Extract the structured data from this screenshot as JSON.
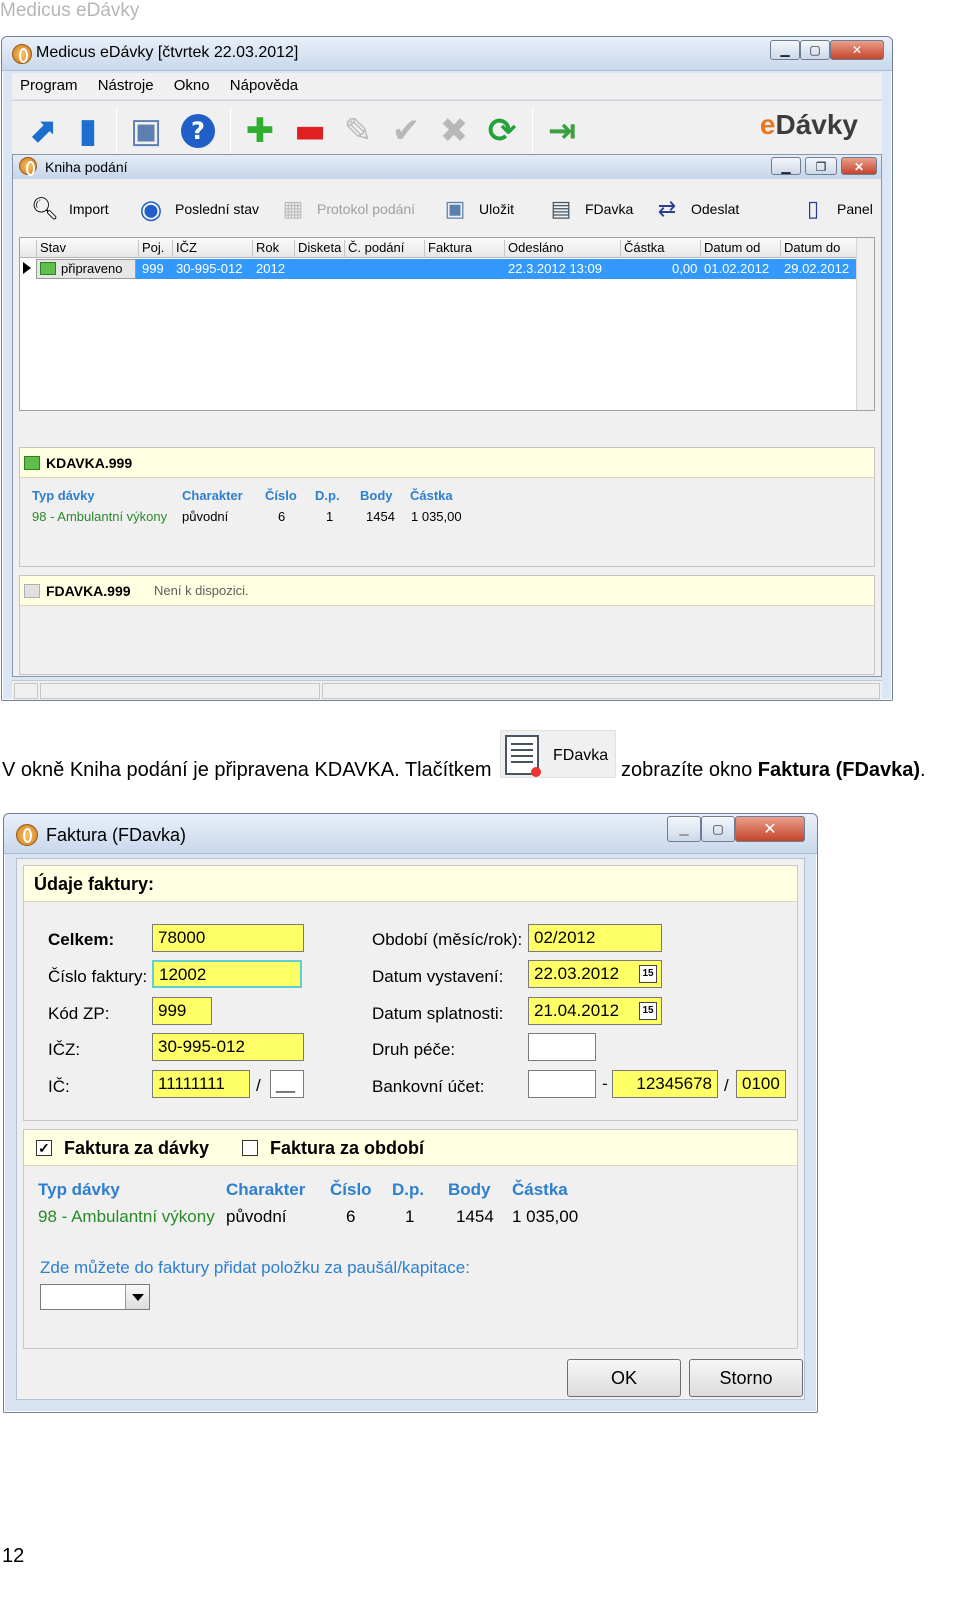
{
  "header_text": "Medicus eDávky",
  "main_window": {
    "title": "Medicus eDávky  [čtvrtek 22.03.2012]",
    "menu": [
      "Program",
      "Nástroje",
      "Okno",
      "Nápověda"
    ],
    "logo": {
      "e": "e",
      "rest": "Dávky"
    },
    "inner_title": "Kniha podání",
    "inner_toolbar": {
      "import": "Import",
      "last_state": "Poslední stav",
      "protocol": "Protokol podání",
      "save": "Uložit",
      "fdavka": "FDavka",
      "send": "Odeslat",
      "panel": "Panel"
    },
    "grid": {
      "columns": [
        "Stav",
        "Poj.",
        "IČZ",
        "Rok",
        "Disketa",
        "Č. podání",
        "Faktura",
        "Odesláno",
        "Částka",
        "Datum od",
        "Datum do"
      ],
      "row": {
        "stav": "připraveno",
        "poj": "999",
        "icz": "30-995-012",
        "rok": "2012",
        "odeslano": "22.3.2012 13:09",
        "castka": "0,00",
        "datum_od": "01.02.2012",
        "datum_do": "29.02.2012"
      }
    },
    "kdavka": {
      "title": "KDAVKA.999",
      "labels": [
        "Typ dávky",
        "Charakter",
        "Číslo",
        "D.p.",
        "Body",
        "Částka"
      ],
      "values": [
        "98 - Ambulantní výkony",
        "původní",
        "6",
        "1",
        "1454",
        "1 035,00"
      ]
    },
    "fdavka": {
      "title": "FDAVKA.999",
      "note": "Není k dispozici."
    }
  },
  "paragraph": {
    "before": "V okně Kniha podání je připravena KDAVKA. Tlačítkem",
    "button_label": "FDavka",
    "after": "zobrazíte okno",
    "bold": "Faktura (FDavka)",
    "end": "."
  },
  "dialog": {
    "title": "Faktura (FDavka)",
    "section_title": "Údaje faktury:",
    "fields": {
      "celkem_label": "Celkem:",
      "celkem": "78000",
      "cislo_faktury_label": "Číslo faktury:",
      "cislo_faktury": "12002",
      "kod_zp_label": "Kód ZP:",
      "kod_zp": "999",
      "icz_label": "IČZ:",
      "icz": "30-995-012",
      "ic_label": "IČ:",
      "ic": "11111111",
      "ic_suffix": "__",
      "obdobi_label": "Období (měsíc/rok):",
      "obdobi": "02/2012",
      "datum_vystaveni_label": "Datum vystavení:",
      "datum_vystaveni": "22.03.2012",
      "datum_splatnosti_label": "Datum splatnosti:",
      "datum_splatnosti": "21.04.2012",
      "druh_pece_label": "Druh péče:",
      "bankovni_ucet_label": "Bankovní účet:",
      "ucet": "12345678",
      "kod_banky": "0100",
      "cal_icon_text": "15"
    },
    "checkbox_davky": "Faktura za dávky",
    "checkbox_obdobi": "Faktura za období",
    "table_labels": [
      "Typ dávky",
      "Charakter",
      "Číslo",
      "D.p.",
      "Body",
      "Částka"
    ],
    "table_values": [
      "98 - Ambulantní výkony",
      "původní",
      "6",
      "1",
      "1454",
      "1 035,00"
    ],
    "paushal_note": "Zde můžete do faktury přidat položku za paušál/kapitace:",
    "ok": "OK",
    "storno": "Storno"
  },
  "page_number": "12"
}
